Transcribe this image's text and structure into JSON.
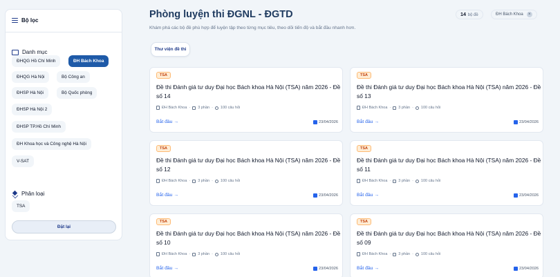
{
  "sidebar": {
    "title": "Bộ lọc",
    "category_title": "Danh mục",
    "categories": [
      {
        "label": "ĐHQG Hồ Chí Minh",
        "active": false
      },
      {
        "label": "ĐH Bách Khoa",
        "active": true
      },
      {
        "label": "ĐHQG Hà Nội",
        "active": false
      },
      {
        "label": "Bộ Công an",
        "active": false
      },
      {
        "label": "ĐHSP Hà Nội",
        "active": false
      },
      {
        "label": "Bộ Quốc phòng",
        "active": false
      },
      {
        "label": "ĐHSP Hà Nội 2",
        "active": false
      },
      {
        "label": "ĐHSP TP.Hồ Chí Minh",
        "active": false
      },
      {
        "label": "ĐH Khoa học và Công nghệ Hà Nội",
        "active": false
      },
      {
        "label": "V-SAT",
        "active": false
      }
    ],
    "type_title": "Phân loại",
    "types": [
      {
        "label": "TSA"
      }
    ],
    "reset_label": "Đặt lại"
  },
  "header": {
    "title": "Phòng luyện thi ĐGNL - ĐGTD",
    "subtitle": "Khám phá các bộ đề phù hợp để luyện tập theo từng mục tiêu, theo dõi tiến độ và bắt đầu nhanh hơn.",
    "count": "14",
    "count_suffix": "bộ đề",
    "active_filter": "ĐH Bách Khoa",
    "remove_icon": "×",
    "tab_label": "Thư viện đề thi"
  },
  "cards": [
    {
      "tag": "TSA",
      "title": "Đề thi Đánh giá tư duy Đại học Bách khoa Hà Nội (TSA) năm 2026 - Đề số 14",
      "school": "ĐH Bách Khoa",
      "parts": "3 phần",
      "questions": "100 câu hỏi",
      "start": "Bắt đầu →",
      "date": "23/04/2026"
    },
    {
      "tag": "TSA",
      "title": "Đề thi Đánh giá tư duy Đại học Bách khoa Hà Nội (TSA) năm 2026 - Đề số 13",
      "school": "ĐH Bách Khoa",
      "parts": "3 phần",
      "questions": "100 câu hỏi",
      "start": "Bắt đầu →",
      "date": "23/04/2026"
    },
    {
      "tag": "TSA",
      "title": "Đề thi Đánh giá tư duy Đại học Bách khoa Hà Nội (TSA) năm 2026 - Đề số 12",
      "school": "ĐH Bách Khoa",
      "parts": "3 phần",
      "questions": "100 câu hỏi",
      "start": "Bắt đầu →",
      "date": "23/04/2026"
    },
    {
      "tag": "TSA",
      "title": "Đề thi Đánh giá tư duy Đại học Bách khoa Hà Nội (TSA) năm 2026 - Đề số 11",
      "school": "ĐH Bách Khoa",
      "parts": "3 phần",
      "questions": "100 câu hỏi",
      "start": "Bắt đầu →",
      "date": "23/04/2026"
    },
    {
      "tag": "TSA",
      "title": "Đề thi Đánh giá tư duy Đại học Bách khoa Hà Nội (TSA) năm 2026 - Đề số 10",
      "school": "ĐH Bách Khoa",
      "parts": "3 phần",
      "questions": "100 câu hỏi",
      "start": "Bắt đầu →",
      "date": "23/04/2026"
    },
    {
      "tag": "TSA",
      "title": "Đề thi Đánh giá tư duy Đại học Bách khoa Hà Nội (TSA) năm 2026 - Đề số 09",
      "school": "ĐH Bách Khoa",
      "parts": "3 phần",
      "questions": "100 câu hỏi",
      "start": "Bắt đầu →",
      "date": "23/04/2026"
    }
  ]
}
